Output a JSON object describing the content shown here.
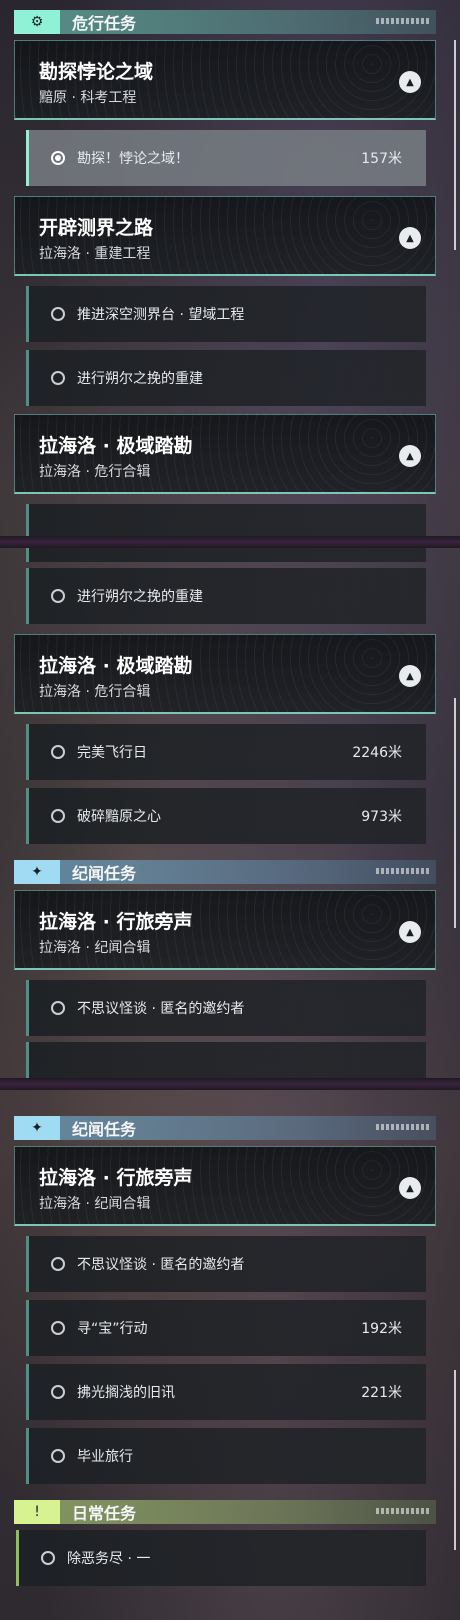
{
  "panels": [
    {
      "category": {
        "title": "危行任务",
        "icon": "gear-badge-icon"
      },
      "groups": [
        {
          "name": "勘探悖论之域",
          "sub": "黯原 · 科考工程",
          "tasks": [
            {
              "name": "勘探！悖论之域！",
              "distance": "157米",
              "selected": true
            }
          ]
        },
        {
          "name": "开辟测界之路",
          "sub": "拉海洛 · 重建工程",
          "tasks": [
            {
              "name": "推进深空测界台 · 望域工程",
              "distance": ""
            },
            {
              "name": "进行朔尔之挽的重建",
              "distance": ""
            }
          ]
        },
        {
          "name": "拉海洛 · 极域踏勘",
          "sub": "拉海洛 · 危行合辑",
          "tasks": []
        }
      ]
    },
    {
      "tasks_top": [
        {
          "name": "进行朔尔之挽的重建",
          "distance": ""
        }
      ],
      "groups": [
        {
          "name": "拉海洛 · 极域踏勘",
          "sub": "拉海洛 · 危行合辑",
          "tasks": [
            {
              "name": "完美飞行日",
              "distance": "2246米"
            },
            {
              "name": "破碎黯原之心",
              "distance": "973米"
            }
          ]
        }
      ],
      "category": {
        "title": "纪闻任务",
        "icon": "sparkle-badge-icon"
      },
      "groups2": [
        {
          "name": "拉海洛 · 行旅旁声",
          "sub": "拉海洛 · 纪闻合辑",
          "tasks": [
            {
              "name": "不思议怪谈 · 匿名的邀约者",
              "distance": ""
            }
          ]
        }
      ]
    },
    {
      "category": {
        "title": "纪闻任务",
        "icon": "sparkle-badge-icon"
      },
      "groups": [
        {
          "name": "拉海洛 · 行旅旁声",
          "sub": "拉海洛 · 纪闻合辑",
          "tasks": [
            {
              "name": "不思议怪谈 · 匿名的邀约者",
              "distance": ""
            },
            {
              "name": "寻“宝”行动",
              "distance": "192米"
            },
            {
              "name": "拂光搁浅的旧讯",
              "distance": "221米"
            },
            {
              "name": "毕业旅行",
              "distance": ""
            }
          ]
        }
      ],
      "category2": {
        "title": "日常任务",
        "icon": "alert-badge-icon"
      },
      "daily": [
        {
          "name": "除恶务尽 · 一",
          "distance": ""
        }
      ]
    }
  ],
  "colors": {
    "accent_teal": "#8ff2d6",
    "accent_blue": "#9fdcf3",
    "accent_green": "#d6f291"
  }
}
